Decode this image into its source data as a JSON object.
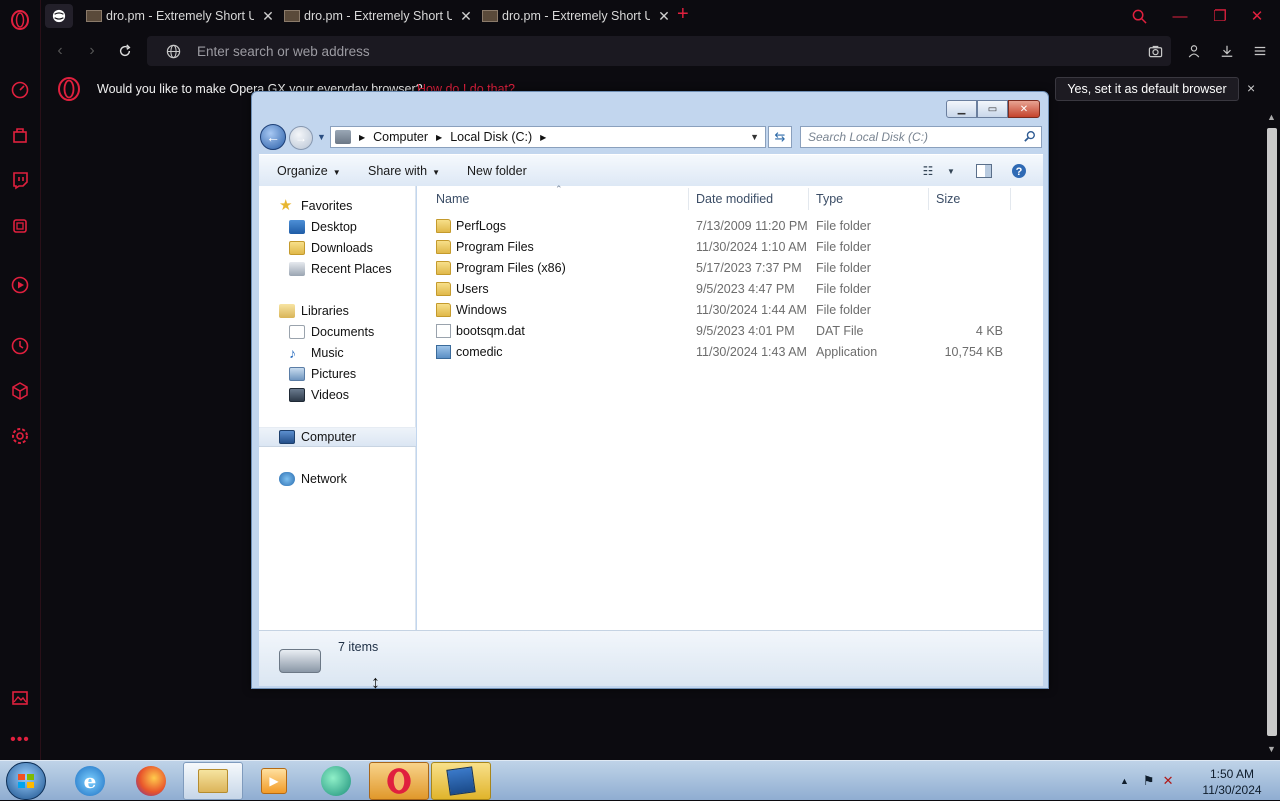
{
  "browser": {
    "tabs": [
      {
        "title": "dro.pm - Extremely Short URLs"
      },
      {
        "title": "dro.pm - Extremely Short URLs"
      },
      {
        "title": "dro.pm - Extremely Short URLs"
      }
    ],
    "address_placeholder": "Enter search or web address",
    "infobar": {
      "message": "Would you like to make Opera GX your everyday browser?",
      "link": "How do I do that?",
      "default_button": "Yes, set it as default browser",
      "close": "×"
    },
    "sidebar_icons": [
      "opera-logo-icon",
      "speed-dial-icon",
      "shopping-bag-icon",
      "twitch-icon",
      "gx-control-icon",
      "player-icon",
      "history-icon",
      "extensions-icon",
      "settings-icon",
      "image-icon",
      "more-icon"
    ],
    "accent_color": "#e0203e"
  },
  "explorer": {
    "breadcrumb": [
      "Computer",
      "Local Disk (C:)"
    ],
    "search_placeholder": "Search Local Disk (C:)",
    "commands": {
      "organize": "Organize",
      "share": "Share with",
      "new_folder": "New folder"
    },
    "nav": {
      "favorites": "Favorites",
      "desktop": "Desktop",
      "downloads": "Downloads",
      "recent": "Recent Places",
      "libraries": "Libraries",
      "documents": "Documents",
      "music": "Music",
      "pictures": "Pictures",
      "videos": "Videos",
      "computer": "Computer",
      "network": "Network"
    },
    "columns": {
      "name": "Name",
      "date": "Date modified",
      "type": "Type",
      "size": "Size"
    },
    "files": [
      {
        "name": "PerfLogs",
        "date": "7/13/2009 11:20 PM",
        "type": "File folder",
        "size": "",
        "kind": "folder"
      },
      {
        "name": "Program Files",
        "date": "11/30/2024 1:10 AM",
        "type": "File folder",
        "size": "",
        "kind": "folder"
      },
      {
        "name": "Program Files (x86)",
        "date": "5/17/2023 7:37 PM",
        "type": "File folder",
        "size": "",
        "kind": "folder"
      },
      {
        "name": "Users",
        "date": "9/5/2023 4:47 PM",
        "type": "File folder",
        "size": "",
        "kind": "folder"
      },
      {
        "name": "Windows",
        "date": "11/30/2024 1:44 AM",
        "type": "File folder",
        "size": "",
        "kind": "folder"
      },
      {
        "name": "bootsqm.dat",
        "date": "9/5/2023 4:01 PM",
        "type": "DAT File",
        "size": "4 KB",
        "kind": "file"
      },
      {
        "name": "comedic",
        "date": "11/30/2024 1:43 AM",
        "type": "Application",
        "size": "10,754 KB",
        "kind": "app"
      }
    ],
    "status": "7 items"
  },
  "taskbar": {
    "apps": [
      "internet-explorer-icon",
      "firefox-icon",
      "file-explorer-icon",
      "media-player-icon",
      "chat-icon",
      "opera-gx-icon",
      "snipping-tool-icon"
    ],
    "time": "1:50 AM",
    "date": "11/30/2024"
  }
}
